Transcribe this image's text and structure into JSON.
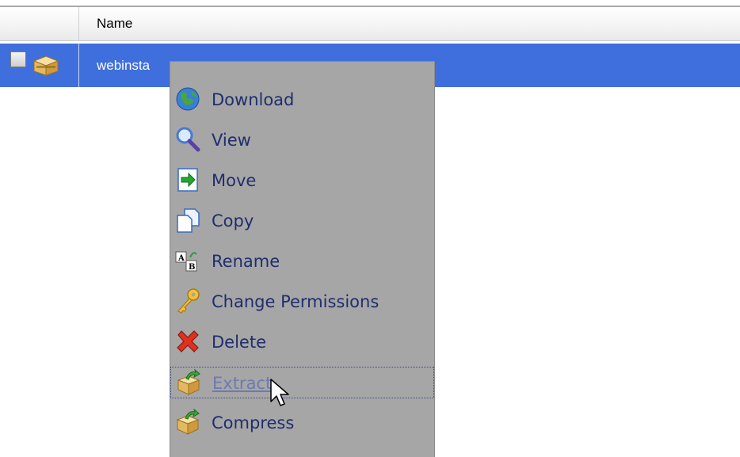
{
  "table": {
    "header": {
      "name_column": "Name"
    },
    "rows": [
      {
        "name": "webinsta",
        "icon": "archive-icon",
        "selected": true,
        "checked": false
      }
    ],
    "selected_row_color": "#3f6fdc"
  },
  "context_menu": {
    "background": "#a6a6a6",
    "items": [
      {
        "label": "Download",
        "icon": "globe-download-icon"
      },
      {
        "label": "View",
        "icon": "magnifier-icon"
      },
      {
        "label": "Move",
        "icon": "move-arrow-icon"
      },
      {
        "label": "Copy",
        "icon": "copy-pages-icon"
      },
      {
        "label": "Rename",
        "icon": "rename-ab-icon"
      },
      {
        "label": "Change Permissions",
        "icon": "key-icon"
      },
      {
        "label": "Delete",
        "icon": "red-x-icon"
      },
      {
        "label": "Extract",
        "icon": "box-extract-icon",
        "hovered": true
      },
      {
        "label": "Compress",
        "icon": "box-compress-icon"
      }
    ]
  },
  "cursor": {
    "icon": "arrow-cursor-icon"
  }
}
